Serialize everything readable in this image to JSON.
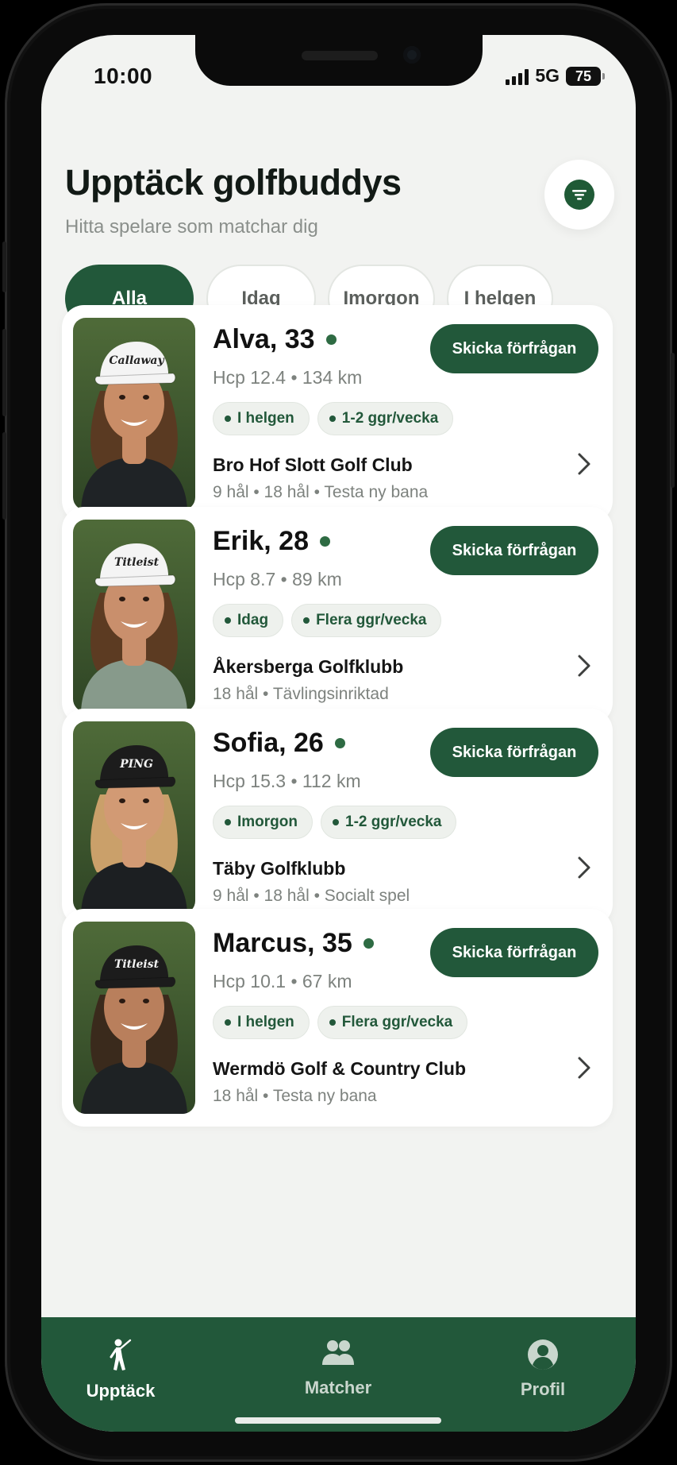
{
  "status_bar": {
    "time": "10:00",
    "network": "5G",
    "battery": "75"
  },
  "header": {
    "title": "Upptäck golfbuddys",
    "subtitle": "Hitta spelare som matchar dig",
    "filter_icon": "filter-icon"
  },
  "filters": [
    {
      "label": "Alla",
      "active": true
    },
    {
      "label": "Idag",
      "active": false
    },
    {
      "label": "Imorgon",
      "active": false
    },
    {
      "label": "I helgen",
      "active": false
    }
  ],
  "players": [
    {
      "name": "Alva, 33",
      "meta": "Hcp 12.4 • 134 km",
      "tags": [
        "I helgen",
        "1-2 ggr/vecka"
      ],
      "club": "Bro Hof Slott Golf Club",
      "details": "9 hål • 18 hål • Testa ny bana",
      "action": "Skicka förfrågan",
      "cap": "Callaway",
      "cap_color": "#f4f4f4",
      "online": true
    },
    {
      "name": "Erik, 28",
      "meta": "Hcp 8.7 • 89 km",
      "tags": [
        "Idag",
        "Flera ggr/vecka"
      ],
      "club": "Åkersberga Golfklubb",
      "details": "18 hål • Tävlingsinriktad",
      "action": "Skicka förfrågan",
      "cap": "Titleist",
      "cap_color": "#f4f4f4",
      "online": true
    },
    {
      "name": "Sofia, 26",
      "meta": "Hcp 15.3 • 112 km",
      "tags": [
        "Imorgon",
        "1-2 ggr/vecka"
      ],
      "club": "Täby Golfklubb",
      "details": "9 hål • 18 hål • Socialt spel",
      "action": "Skicka förfrågan",
      "cap": "PING",
      "cap_color": "#1c1c1c",
      "online": true
    },
    {
      "name": "Marcus, 35",
      "meta": "Hcp 10.1 • 67 km",
      "tags": [
        "I helgen",
        "Flera ggr/vecka"
      ],
      "club": "Wermdö Golf & Country Club",
      "details": "18 hål • Testa ny bana",
      "action": "Skicka förfrågan",
      "cap": "Titleist",
      "cap_color": "#1c1c1c",
      "online": true
    }
  ],
  "tabbar": [
    {
      "label": "Upptäck",
      "icon": "golfer-icon",
      "active": true
    },
    {
      "label": "Matcher",
      "icon": "people-icon",
      "active": false
    },
    {
      "label": "Profil",
      "icon": "profile-icon",
      "active": false
    }
  ],
  "colors": {
    "accent": "#22583a",
    "background": "#f2f3f1",
    "online": "#2e6b43"
  }
}
